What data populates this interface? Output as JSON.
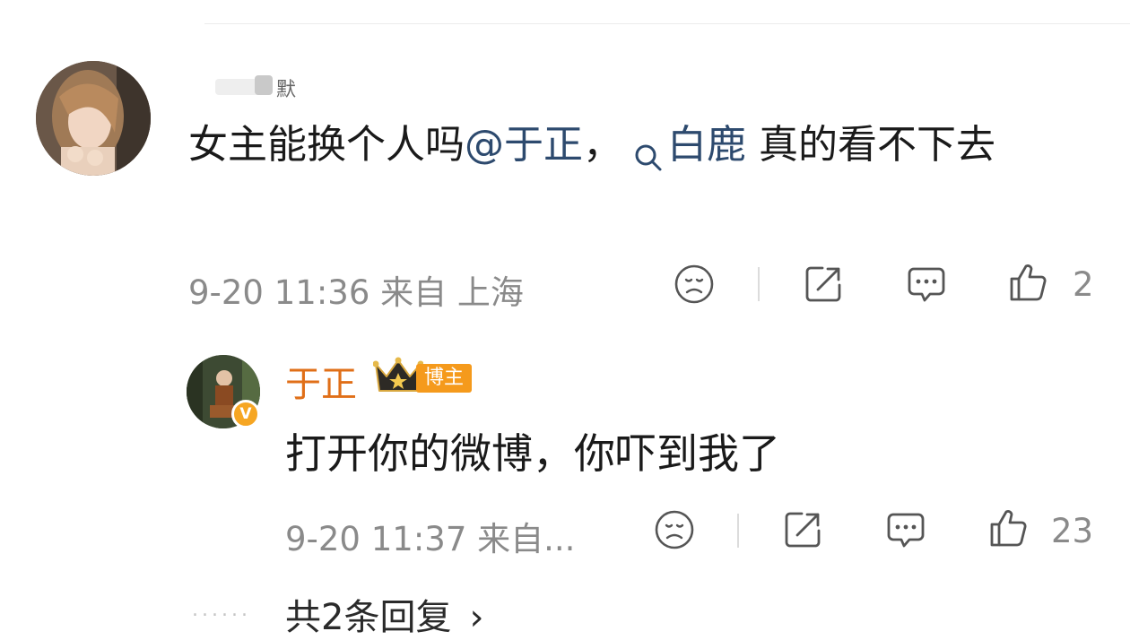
{
  "main_comment": {
    "username": "默",
    "text_before_mention": "女主能换个人吗",
    "mention": "@于正",
    "text_mid": "，",
    "topic": "白鹿",
    "text_after": " 真的看不下去",
    "meta": "9-20 11:36 来自 上海",
    "like_count": "2"
  },
  "reply": {
    "name": "于正",
    "tag": "博主",
    "verify_badge": "V",
    "text": "打开你的微博，你吓到我了",
    "meta": "9-20 11:37 来自...",
    "like_count": "23"
  },
  "footer": {
    "dots": "......",
    "more_replies": "共2条回复",
    "chevron": "›"
  },
  "icons": [
    "sad-face-icon",
    "share-icon",
    "comment-icon",
    "like-icon",
    "magnifier-icon",
    "crown-icon"
  ]
}
